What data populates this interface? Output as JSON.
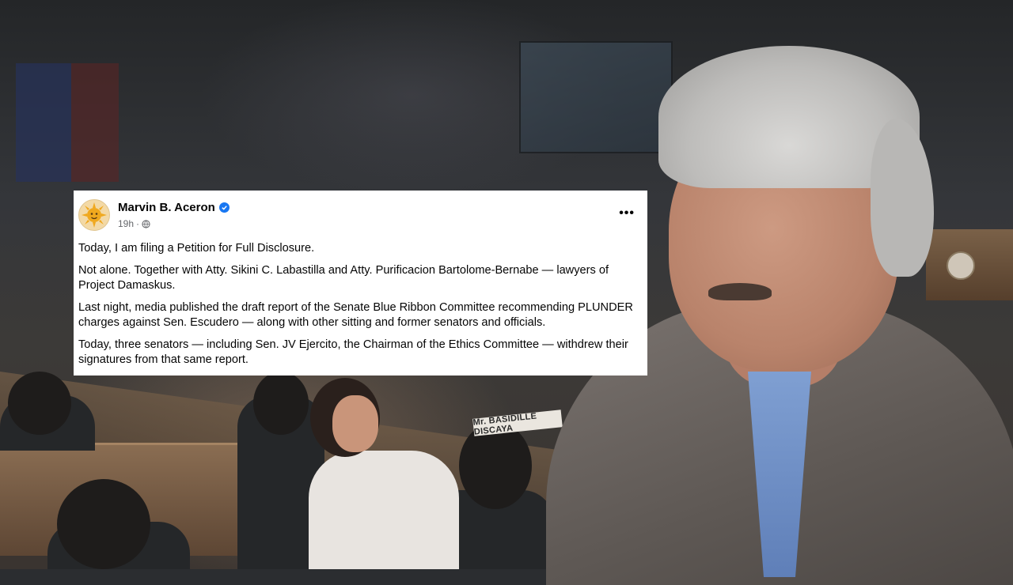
{
  "background": {
    "nameplate_text": "Mr. BASIDILLE DISCAYA",
    "nameplate2_text": "Mr"
  },
  "post": {
    "author": "Marvin B. Aceron",
    "verified_icon": "verified-badge-icon",
    "timestamp": "19h",
    "audience_icon": "globe-icon",
    "more_label": "•••",
    "paragraphs": [
      "Today, I am filing a Petition for Full Disclosure.",
      "Not alone. Together with Atty. Sikini C. Labastilla and Atty. Purificacion Bartolome-Bernabe — lawyers of Project Damaskus.",
      "Last night, media published the draft report of the Senate Blue Ribbon Committee recommending PLUNDER charges against Sen. Escudero — along with other sitting and former senators and officials.",
      "Today, three senators — including Sen. JV Ejercito, the Chairman of the Ethics Committee — withdrew their signatures from that same report."
    ]
  },
  "colors": {
    "verified": "#1877f2",
    "card_bg": "#ffffff",
    "meta_text": "#65676b"
  }
}
